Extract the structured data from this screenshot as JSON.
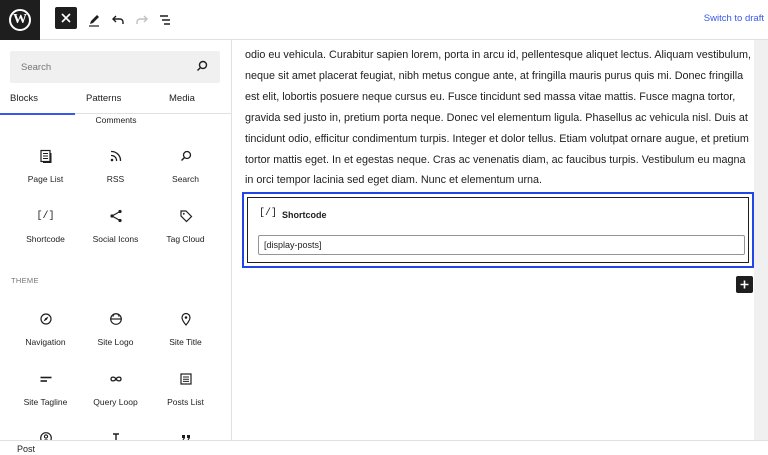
{
  "header": {
    "switch_to_draft": "Switch to draft"
  },
  "sidebar": {
    "search_placeholder": "Search",
    "tabs": [
      {
        "label": "Blocks",
        "active": true
      },
      {
        "label": "Patterns",
        "active": false
      },
      {
        "label": "Media",
        "active": false
      }
    ],
    "partial_item": "Comments",
    "widgets": [
      {
        "label": "Page List",
        "icon": "page-list-icon"
      },
      {
        "label": "RSS",
        "icon": "rss-icon"
      },
      {
        "label": "Search",
        "icon": "search-icon"
      },
      {
        "label": "Shortcode",
        "icon": "shortcode-icon"
      },
      {
        "label": "Social Icons",
        "icon": "share-icon"
      },
      {
        "label": "Tag Cloud",
        "icon": "tag-icon"
      }
    ],
    "theme_heading": "THEME",
    "theme": [
      {
        "label": "Navigation",
        "icon": "compass-icon"
      },
      {
        "label": "Site Logo",
        "icon": "site-logo-icon"
      },
      {
        "label": "Site Title",
        "icon": "map-pin-icon"
      },
      {
        "label": "Site Tagline",
        "icon": "tagline-icon"
      },
      {
        "label": "Query Loop",
        "icon": "loop-icon"
      },
      {
        "label": "Posts List",
        "icon": "posts-list-icon"
      }
    ]
  },
  "editor": {
    "paragraph": "odio eu vehicula. Curabitur sapien lorem, porta in arcu id, pellentesque aliquet lectus. Aliquam vestibulum, neque sit amet placerat feugiat, nibh metus congue ante, at fringilla mauris purus quis mi. Donec fringilla est elit, lobortis posuere neque cursus eu. Fusce tincidunt sed massa vitae mattis. Fusce magna tortor, gravida sed justo in, pretium porta neque. Donec vel elementum ligula. Phasellus ac vehicula nisl. Duis at tincidunt odio, efficitur condimentum turpis. Integer et dolor tellus. Etiam volutpat ornare augue, et pretium tortor mattis eget. In et egestas neque. Cras ac venenatis diam, ac faucibus turpis. Vestibulum eu magna in orci tempor lacinia sed eget diam. Nunc et elementum urna.",
    "shortcode_block": {
      "icon_glyph": "[/]",
      "title": "Shortcode",
      "value": "[display-posts]"
    }
  },
  "footer": {
    "breadcrumb": "Post"
  }
}
